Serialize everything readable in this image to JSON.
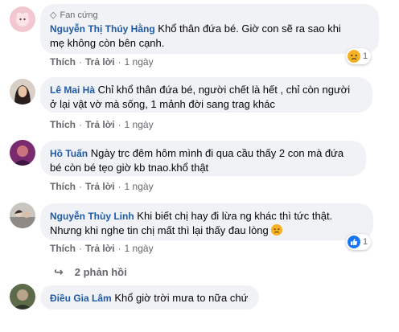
{
  "comments": [
    {
      "badge": "Fan cứng",
      "author": "Nguyễn Thị Thúy Hằng",
      "text_line1": "Khổ thân đứa bé. Giờ con sẽ ra sao khi",
      "text_line2": "mẹ không còn bên cạnh.",
      "like": "Thích",
      "reply": "Trả lời",
      "time": "1 ngày",
      "reaction_icon": "sad-reaction-icon",
      "reaction_count": "1"
    },
    {
      "author": "Lê Mai Hà",
      "text_line1": "Chỉ khổ thân đứa bé, người chết là hết , chỉ còn người",
      "text_line2": "ở lại vật vờ mà sống, 1 mảnh đời sang trag khác",
      "like": "Thích",
      "reply": "Trả lời",
      "time": "1 ngày"
    },
    {
      "author": "Hồ Tuấn",
      "text_line1": "Ngày trc đêm hôm mình đi qua cầu thấy 2 con mà đứa",
      "text_line2": "bé còn bé tẹo giờ kb tnao.khổ thật",
      "like": "Thích",
      "reply": "Trả lời",
      "time": "1 ngày"
    },
    {
      "author": "Nguyễn Thùy Linh",
      "text_line1": "Khi biết chị hay đi lừa ng khác thì tức thật.",
      "text_line2": "Nhưng khi nghe tin chị mất thì lại thấy đau lòng",
      "like": "Thích",
      "reply": "Trả lời",
      "time": "1 ngày",
      "reaction_icon": "like-reaction-icon",
      "reaction_count": "1",
      "replies_label": "2 phản hồi"
    },
    {
      "author": "Điều Gia Lâm",
      "text_line1": "Khổ giờ trời mưa to nữa chứ"
    }
  ],
  "colors": {
    "bubble": "#f0f2f5",
    "author": "#1f5aa8",
    "meta": "#65676b",
    "like_blue": "#1877f2",
    "sad_yellow": "#f7b125"
  }
}
